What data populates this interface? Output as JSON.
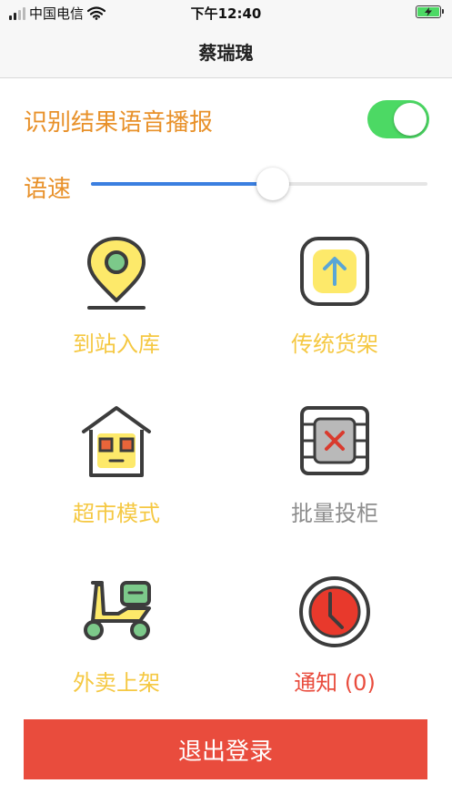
{
  "status_bar": {
    "carrier": "中国电信",
    "time": "下午12:40"
  },
  "nav": {
    "title": "蔡瑞瑰"
  },
  "settings": {
    "voice_label": "识别结果语音播报",
    "voice_enabled": true,
    "speed_label": "语速",
    "speed_level": 0.54
  },
  "grid": {
    "items": [
      {
        "label": "到站入库",
        "icon": "location-pin-icon",
        "color": "#f5c842"
      },
      {
        "label": "传统货架",
        "icon": "upload-arrow-icon",
        "color": "#f5c842"
      },
      {
        "label": "超市模式",
        "icon": "house-robot-icon",
        "color": "#f5c842"
      },
      {
        "label": "批量投柜",
        "icon": "locker-x-icon",
        "color": "#8e8e8e"
      },
      {
        "label": "外卖上架",
        "icon": "scooter-icon",
        "color": "#f5c842"
      },
      {
        "label": "通知 (0)",
        "icon": "clock-icon",
        "color": "#e94c3d"
      }
    ]
  },
  "logout": {
    "label": "退出登录"
  },
  "colors": {
    "accent_orange": "#e8912a",
    "toggle_green": "#4cd964",
    "slider_blue": "#3b7fe0",
    "logout_red": "#e94c3d",
    "icon_yellow": "#fde96a",
    "icon_dark": "#3c3c3c"
  }
}
